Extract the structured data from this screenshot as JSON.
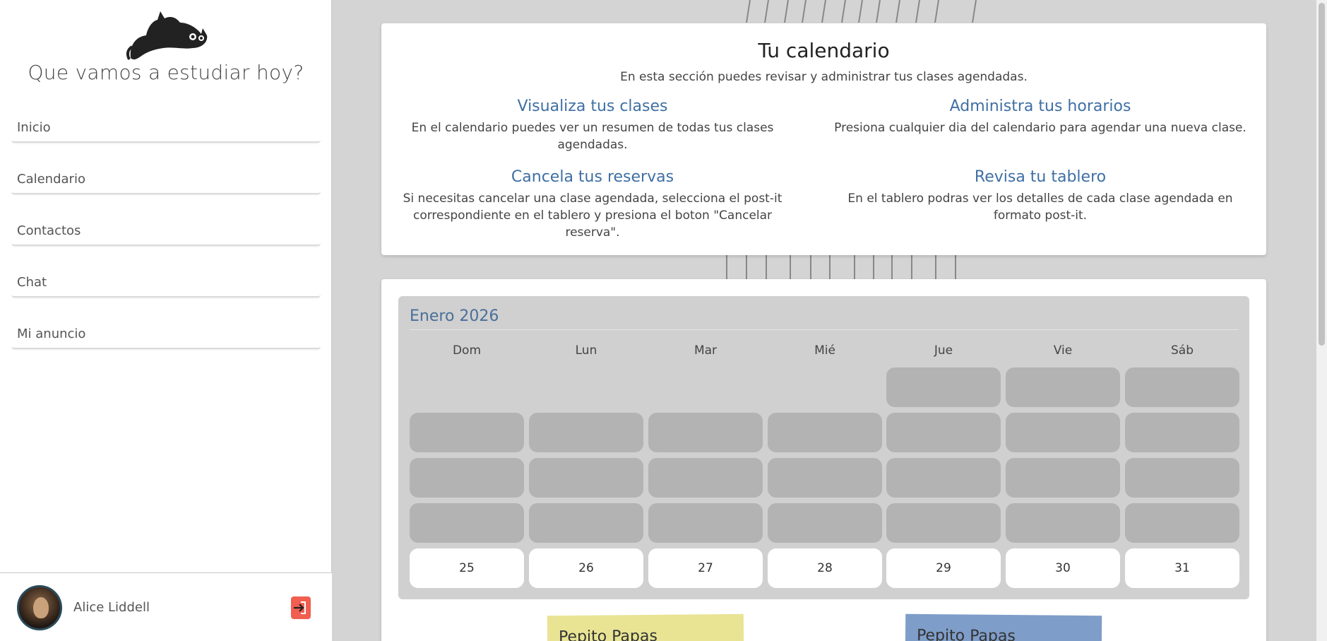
{
  "sidebar": {
    "tagline": "Que vamos a estudiar hoy?",
    "nav": [
      "Inicio",
      "Calendario",
      "Contactos",
      "Chat",
      "Mi anuncio"
    ],
    "user_name": "Alice Liddell"
  },
  "info": {
    "title": "Tu calendario",
    "subtitle": "En esta sección puedes revisar y administrar tus clases agendadas.",
    "features": [
      {
        "title": "Visualiza tus clases",
        "text": "En el calendario puedes ver un resumen de todas tus clases agendadas."
      },
      {
        "title": "Administra tus horarios",
        "text": "Presiona cualquier dia del calendario para agendar una nueva clase."
      },
      {
        "title": "Cancela tus reservas",
        "text": "Si necesitas cancelar una clase agendada, selecciona el post-it correspondiente en el tablero y presiona el boton \"Cancelar reserva\"."
      },
      {
        "title": "Revisa tu tablero",
        "text": "En el tablero podras ver los detalles de cada clase agendada en formato post-it."
      }
    ]
  },
  "calendar": {
    "month": "Enero 2026",
    "weekdays": [
      "Dom",
      "Lun",
      "Mar",
      "Mié",
      "Jue",
      "Vie",
      "Sáb"
    ],
    "last_row": [
      "25",
      "26",
      "27",
      "28",
      "29",
      "30",
      "31"
    ]
  },
  "postits": [
    {
      "label": "Pepito Papas",
      "color": "#e8e494"
    },
    {
      "label": "Pepito Papas",
      "color": "#7e9dc9"
    }
  ],
  "colors": {
    "accent": "#3f6fa3",
    "logout": "#f05f50"
  }
}
